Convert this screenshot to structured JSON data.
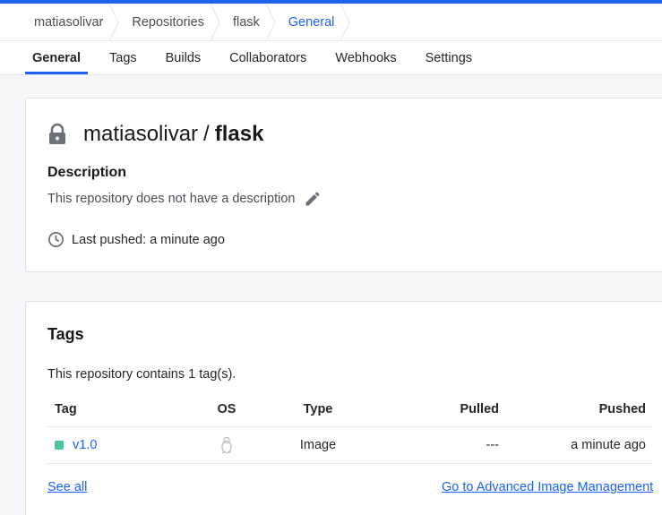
{
  "breadcrumb": [
    {
      "label": "matiasolivar"
    },
    {
      "label": "Repositories"
    },
    {
      "label": "flask"
    },
    {
      "label": "General"
    }
  ],
  "tabs": [
    {
      "label": "General",
      "active": true
    },
    {
      "label": "Tags"
    },
    {
      "label": "Builds"
    },
    {
      "label": "Collaborators"
    },
    {
      "label": "Webhooks"
    },
    {
      "label": "Settings"
    }
  ],
  "repo": {
    "owner": "matiasolivar",
    "separator": "/",
    "name": "flask",
    "icon": "lock-icon",
    "description_heading": "Description",
    "description_text": "This repository does not have a description",
    "last_pushed": "Last pushed: a minute ago"
  },
  "tags_section": {
    "heading": "Tags",
    "count_text": "This repository contains 1 tag(s).",
    "columns": {
      "tag": "Tag",
      "os": "OS",
      "type": "Type",
      "pulled": "Pulled",
      "pushed": "Pushed"
    },
    "rows": [
      {
        "tag": "v1.0",
        "os_icon": "linux-penguin-icon",
        "type": "Image",
        "pulled": "---",
        "pushed": "a minute ago"
      }
    ],
    "see_all": "See all",
    "advanced_link": "Go to Advanced Image Management"
  },
  "colors": {
    "accent": "#1d63ed",
    "tag_status": "#49c7a0"
  }
}
